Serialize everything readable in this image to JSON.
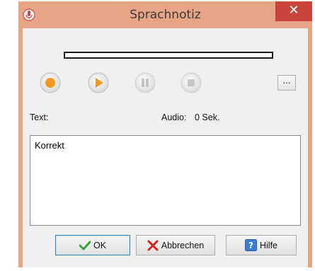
{
  "window": {
    "title": "Sprachnotiz",
    "close_glyph": "✕",
    "app_icon": "microphone-icon"
  },
  "controls": {
    "record": "record-icon",
    "play": "play-icon",
    "pause": "pause-icon",
    "stop": "stop-icon",
    "more_label": "..."
  },
  "labels": {
    "text": "Text:",
    "audio": "Audio:",
    "audio_value": "0 Sek."
  },
  "note": {
    "value": "Korrekt"
  },
  "buttons": {
    "ok": "OK",
    "cancel": "Abbrechen",
    "help": "Hilfe"
  },
  "colors": {
    "frame": "#e8a585",
    "close": "#c9443a",
    "record": "#f39a1e",
    "disabled": "#c4c4c4"
  }
}
